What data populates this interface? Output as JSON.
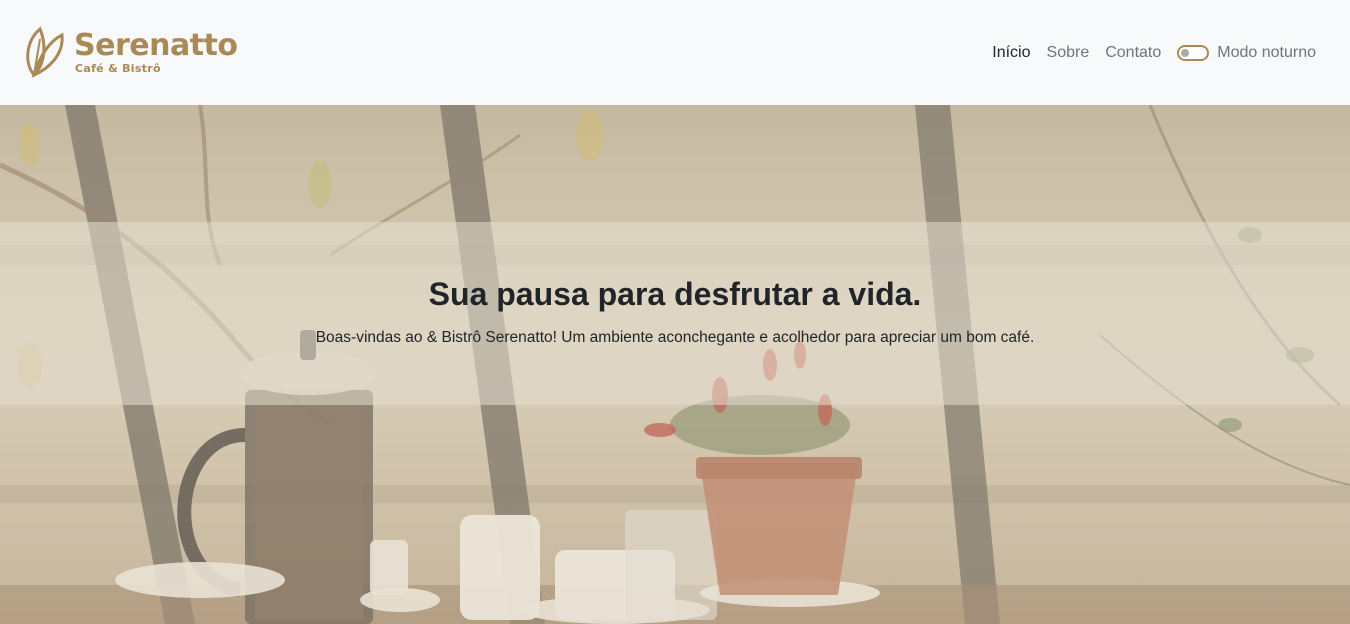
{
  "brand": {
    "name": "Serenatto",
    "subtitle": "Café & Bistrô",
    "logo_icon": "leaf-icon",
    "color": "#a98a56"
  },
  "nav": {
    "items": [
      {
        "label": "Início",
        "active": true
      },
      {
        "label": "Sobre",
        "active": false
      },
      {
        "label": "Contato",
        "active": false
      }
    ],
    "dark_mode_label": "Modo noturno",
    "dark_mode_on": false
  },
  "hero": {
    "title": "Sua pausa para desfrutar a vida.",
    "text": "Boas-vindas ao & Bistrô Serenatto! Um ambiente aconchegante e acolhedor para apreciar um bom café."
  }
}
